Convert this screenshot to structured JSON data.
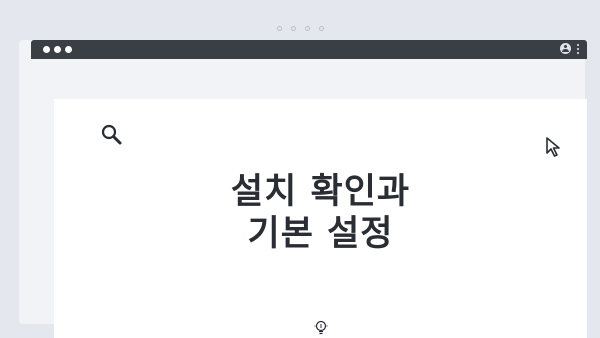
{
  "window": {
    "traffic_lights": 3,
    "header_icons": [
      "user-icon",
      "more-vertical-icon"
    ]
  },
  "content": {
    "title_line1": "설치 확인과",
    "title_line2": "기본 설정",
    "icons": [
      "search-icon",
      "cursor-icon",
      "lightbulb-icon"
    ]
  },
  "colors": {
    "background": "#e4e8ee",
    "titlebar": "#3a3f46",
    "content": "#ffffff",
    "text": "#2a2d33"
  }
}
